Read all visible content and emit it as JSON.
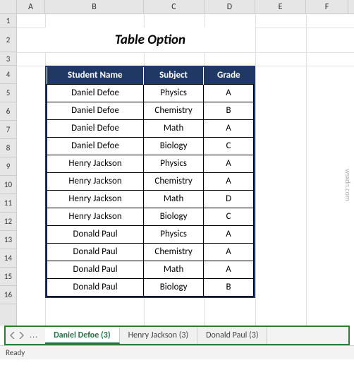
{
  "columns": [
    "A",
    "B",
    "C",
    "D",
    "E",
    "F"
  ],
  "rows": [
    "1",
    "2",
    "3",
    "4",
    "5",
    "6",
    "7",
    "8",
    "9",
    "10",
    "11",
    "12",
    "13",
    "14",
    "15",
    "16"
  ],
  "title": "Table Option",
  "table": {
    "headers": {
      "student": "Student Name",
      "subject": "Subject",
      "grade": "Grade"
    },
    "data": [
      {
        "student": "Daniel Defoe",
        "subject": "Physics",
        "grade": "A"
      },
      {
        "student": "Daniel Defoe",
        "subject": "Chemistry",
        "grade": "B"
      },
      {
        "student": "Daniel Defoe",
        "subject": "Math",
        "grade": "A"
      },
      {
        "student": "Daniel Defoe",
        "subject": "Biology",
        "grade": "C"
      },
      {
        "student": "Henry Jackson",
        "subject": "Physics",
        "grade": "A"
      },
      {
        "student": "Henry Jackson",
        "subject": "Chemistry",
        "grade": "A"
      },
      {
        "student": "Henry Jackson",
        "subject": "Math",
        "grade": "D"
      },
      {
        "student": "Henry Jackson",
        "subject": "Biology",
        "grade": "C"
      },
      {
        "student": "Donald Paul",
        "subject": "Physics",
        "grade": "A"
      },
      {
        "student": "Donald Paul",
        "subject": "Chemistry",
        "grade": "A"
      },
      {
        "student": "Donald Paul",
        "subject": "Math",
        "grade": "A"
      },
      {
        "student": "Donald Paul",
        "subject": "Biology",
        "grade": "B"
      }
    ]
  },
  "tabs": [
    {
      "label": "Daniel Defoe (3)",
      "active": true
    },
    {
      "label": "Henry Jackson (3)",
      "active": false
    },
    {
      "label": "Donald Paul (3)",
      "active": false
    }
  ],
  "nav_dots": "...",
  "status": "Ready",
  "watermark": "wsxdn.com"
}
